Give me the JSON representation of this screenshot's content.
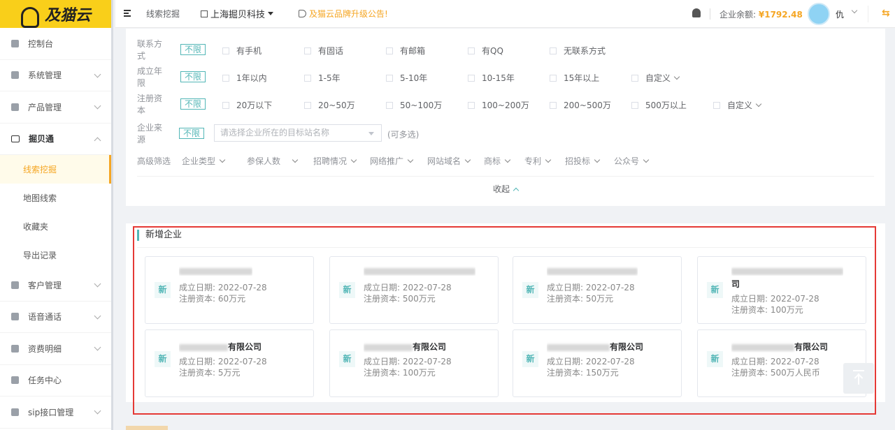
{
  "logo": {
    "text": "及猫云"
  },
  "sidebar": {
    "items": [
      {
        "label": "控制台",
        "icon": "dashboard-icon",
        "chevron": false
      },
      {
        "label": "系统管理",
        "icon": "system-icon",
        "chevron": true
      },
      {
        "label": "产品管理",
        "icon": "product-icon",
        "chevron": true
      },
      {
        "label": "掘贝通",
        "icon": "book-icon",
        "chevron": true,
        "open": true,
        "children": [
          {
            "label": "线索挖掘",
            "active": true
          },
          {
            "label": "地图线索"
          },
          {
            "label": "收藏夹"
          },
          {
            "label": "导出记录"
          }
        ]
      },
      {
        "label": "客户管理",
        "icon": "user-icon",
        "chevron": true
      },
      {
        "label": "语音通话",
        "icon": "chat-icon",
        "chevron": true
      },
      {
        "label": "资费明细",
        "icon": "bill-icon",
        "chevron": true
      },
      {
        "label": "任务中心",
        "icon": "task-icon",
        "chevron": false
      },
      {
        "label": "sip接口管理",
        "icon": "sip-icon",
        "chevron": true
      }
    ]
  },
  "topbar": {
    "breadcrumb": "线索挖掘",
    "company": "上海掘贝科技",
    "notice": "及猫云品牌升级公告!",
    "balance_label": "企业余额:",
    "balance_value": "¥1792.48",
    "username": "仇"
  },
  "filters": {
    "unlimited_label": "不限",
    "contact": {
      "label": "联系方式",
      "options": [
        "有手机",
        "有固话",
        "有邮箱",
        "有QQ",
        "无联系方式"
      ]
    },
    "founded": {
      "label": "成立年限",
      "options": [
        "1年以内",
        "1-5年",
        "5-10年",
        "10-15年",
        "15年以上",
        "自定义"
      ]
    },
    "capital": {
      "label": "注册资本",
      "options": [
        "20万以下",
        "20~50万",
        "50~100万",
        "100~200万",
        "200~500万",
        "500万以上",
        "自定义"
      ]
    },
    "source": {
      "label": "企业来源",
      "placeholder": "请选择企业所在的目标站名称",
      "hint": "(可多选)"
    },
    "advanced": {
      "label": "高级筛选",
      "options": [
        "企业类型",
        "参保人数",
        "招聘情况",
        "网络推广",
        "网站域名",
        "商标",
        "专利",
        "招投标",
        "公众号"
      ]
    },
    "collapse_label": "收起"
  },
  "new_companies": {
    "title": "新增企业",
    "badge": "新",
    "date_label": "成立日期:",
    "capital_label": "注册资本:",
    "cards": [
      {
        "name_suffix": "",
        "date": "2022-07-28",
        "capital": "60万元"
      },
      {
        "name_suffix": "",
        "date": "2022-07-28",
        "capital": "500万元"
      },
      {
        "name_suffix": "",
        "date": "2022-07-28",
        "capital": "50万元"
      },
      {
        "name_suffix": "司",
        "date": "2022-07-28",
        "capital": "100万元"
      },
      {
        "name_suffix": "有限公司",
        "date": "2022-07-28",
        "capital": "5万元"
      },
      {
        "name_suffix": "有限公司",
        "date": "2022-07-28",
        "capital": "100万元"
      },
      {
        "name_suffix": "有限公司",
        "date": "2022-07-28",
        "capital": "150万元"
      },
      {
        "name_suffix": "有限公司",
        "date": "2022-07-28",
        "capital": "500万人民币"
      }
    ]
  },
  "colors": {
    "accent": "#52b6b6",
    "brand": "#f9cf1a",
    "warning": "#f5a623",
    "highlight": "#e53935"
  }
}
